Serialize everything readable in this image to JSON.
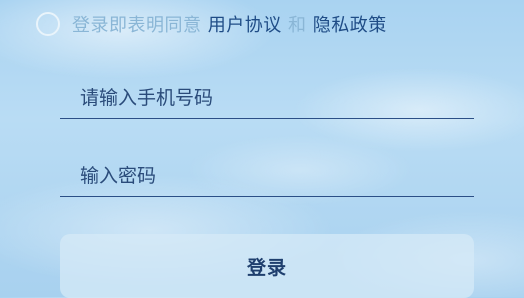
{
  "agreement": {
    "prefix": "登录即表明同意",
    "user_agreement": "用户协议",
    "and": "和",
    "privacy_policy": "隐私政策",
    "checked": false
  },
  "phone": {
    "value": "",
    "placeholder": "请输入手机号码"
  },
  "password": {
    "value": "",
    "placeholder": "输入密码"
  },
  "login_button": {
    "label": "登录"
  },
  "colors": {
    "link": "#1f4c86",
    "muted_text": "#8ab6d6",
    "underline": "#2b4f86",
    "button_bg": "#d6e9f7"
  }
}
